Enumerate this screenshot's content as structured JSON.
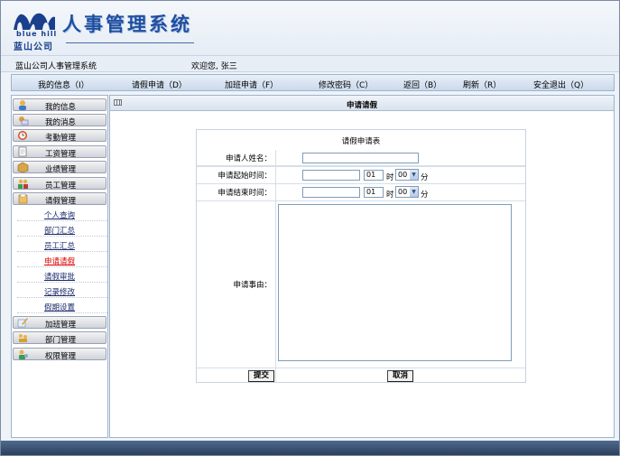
{
  "header": {
    "logo_en": "blue hill",
    "logo_cn": "蓝山公司",
    "title": "人事管理系统"
  },
  "userbar": {
    "system_name": "蓝山公司人事管理系统",
    "welcome": "欢迎您, 张三"
  },
  "nav": [
    {
      "label": "我的信息（I）"
    },
    {
      "label": "请假申请（D）"
    },
    {
      "label": "加班申请（F）"
    },
    {
      "label": "修改密码（C）"
    },
    {
      "label": "返回（B）"
    },
    {
      "label": "刷新（R）"
    },
    {
      "label": "安全退出（Q）"
    }
  ],
  "sidebar": {
    "menus_top": [
      {
        "label": "我的信息",
        "icon": "user-info-icon"
      },
      {
        "label": "我的消息",
        "icon": "message-icon"
      },
      {
        "label": "考勤管理",
        "icon": "clock-icon"
      },
      {
        "label": "工资管理",
        "icon": "document-icon"
      },
      {
        "label": "业绩管理",
        "icon": "box-icon"
      },
      {
        "label": "员工管理",
        "icon": "users-icon"
      },
      {
        "label": "请假管理",
        "icon": "folder-icon"
      }
    ],
    "sub_items": [
      {
        "label": "个人查询"
      },
      {
        "label": "部门汇总"
      },
      {
        "label": "员工汇总"
      },
      {
        "label": "申请请假",
        "active": true
      },
      {
        "label": "请假审批"
      },
      {
        "label": "记录修改"
      },
      {
        "label": "假期设置"
      }
    ],
    "menus_bottom": [
      {
        "label": "加班管理",
        "icon": "edit-icon"
      },
      {
        "label": "部门管理",
        "icon": "group-icon"
      },
      {
        "label": "权限管理",
        "icon": "permission-icon"
      }
    ]
  },
  "main": {
    "title": "申请请假",
    "form": {
      "caption": "请假申请表",
      "name_label": "申请人姓名：",
      "start_label": "申请起始时间：",
      "end_label": "申请结束时间：",
      "reason_label": "申请事由：",
      "start_hour": "01",
      "start_minute": "00",
      "end_hour": "01",
      "end_minute": "00",
      "hour_unit": "时",
      "minute_unit": "分",
      "submit": "提交",
      "cancel": "取消"
    }
  },
  "colors": {
    "title_blue": "#1f4fa0",
    "active_link": "#dd0000"
  }
}
